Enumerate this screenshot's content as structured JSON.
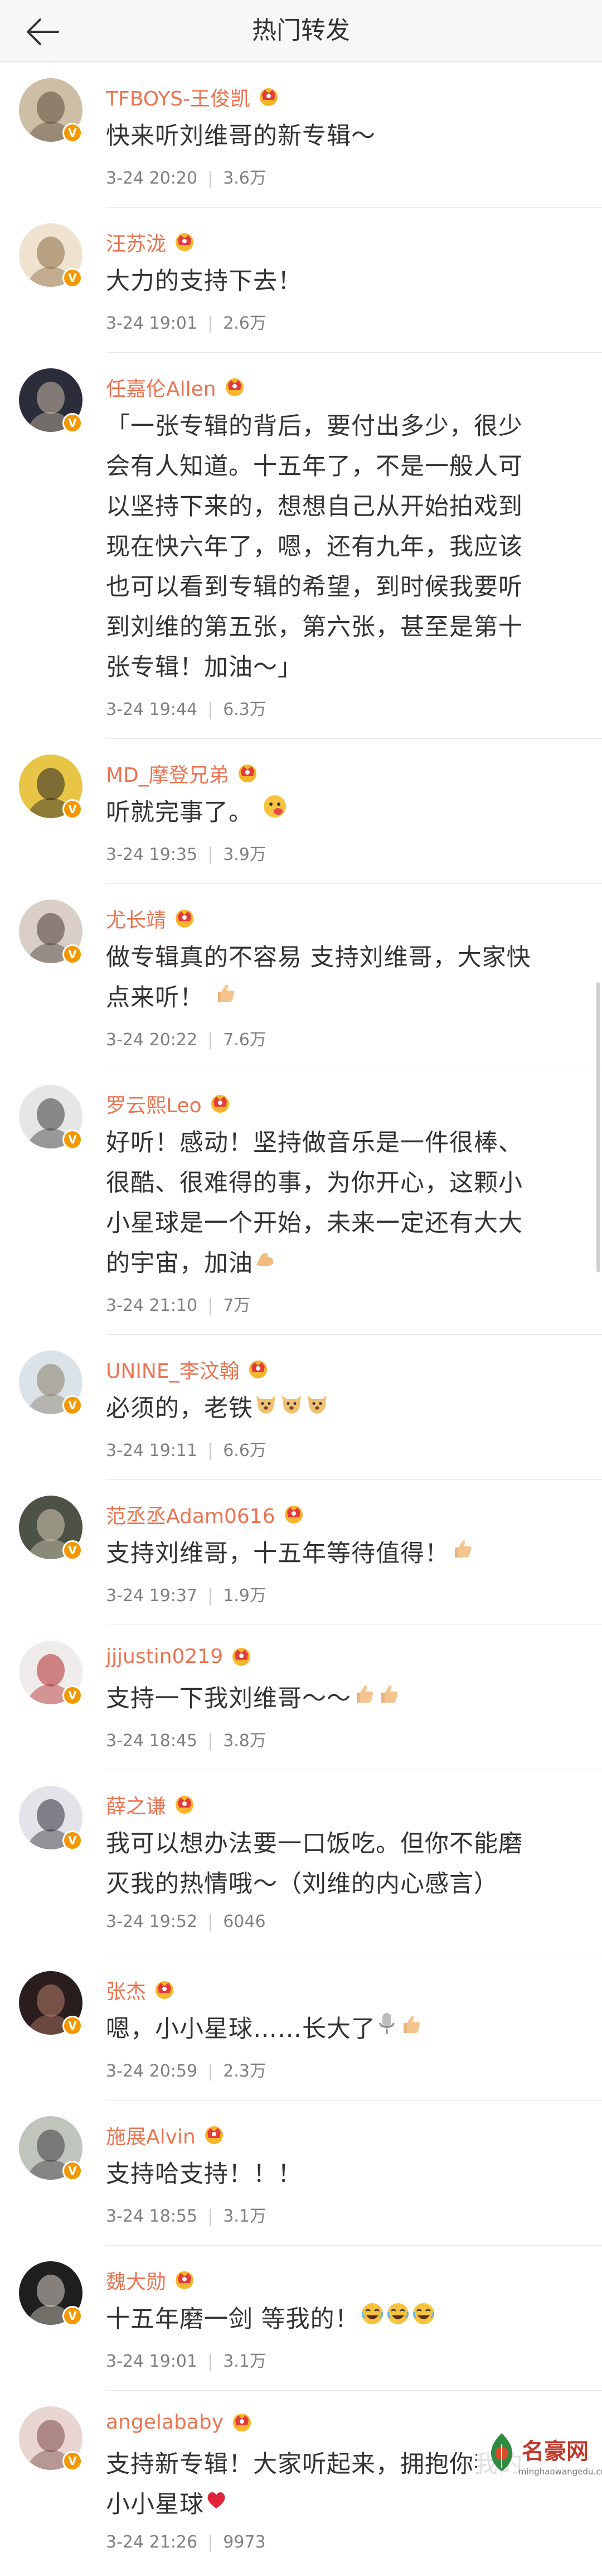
{
  "header": {
    "title": "热门转发"
  },
  "posts": [
    {
      "name": "TFBOYS-王俊凯",
      "lines": [
        "快来听刘维哥的新专辑～"
      ],
      "time": "3-24 20:20",
      "likes": "3.6万",
      "avatar_bg": "#cdbfa6",
      "avatar_fg": "#5b4a3a",
      "emoji": ""
    },
    {
      "name": "汪苏泷",
      "lines": [
        "大力的支持下去！"
      ],
      "time": "3-24 19:01",
      "likes": "2.6万",
      "avatar_bg": "#efe3cf",
      "avatar_fg": "#8b6a45",
      "emoji": ""
    },
    {
      "name": "任嘉伦Allen",
      "lines": [
        "「一张专辑的背后，要付出多少，很少",
        "会有人知道。十五年了，不是一般人可",
        "以坚持下来的，想想自己从开始拍戏到",
        "现在快六年了，嗯，还有九年，我应该",
        "也可以看到专辑的希望，到时候我要听",
        "到刘维的第五张，第六张，甚至是第十",
        "张专辑！加油～」"
      ],
      "time": "3-24 19:44",
      "likes": "6.3万",
      "avatar_bg": "#2b2e3a",
      "avatar_fg": "#c9b9a8",
      "emoji": ""
    },
    {
      "name": "MD_摩登兄弟",
      "lines": [
        "听就完事了。"
      ],
      "time": "3-24 19:35",
      "likes": "3.9万",
      "avatar_bg": "#e8c547",
      "avatar_fg": "#222222",
      "emoji": "face"
    },
    {
      "name": "尤长靖",
      "lines": [
        "做专辑真的不容易 支持刘维哥，大家快",
        "点来听！"
      ],
      "time": "3-24 20:22",
      "likes": "7.6万",
      "avatar_bg": "#d9cfc8",
      "avatar_fg": "#4a3b35",
      "emoji": "thumb"
    },
    {
      "name": "罗云熙Leo",
      "lines": [
        "好听！感动！坚持做音乐是一件很棒、",
        "很酷、很难得的事，为你开心，这颗小",
        "小星球是一个开始，未来一定还有大大",
        "的宇宙，加油"
      ],
      "time": "3-24 21:10",
      "likes": "7万",
      "avatar_bg": "#e6e6e6",
      "avatar_fg": "#3a3a3a",
      "emoji": "muscle"
    },
    {
      "name": "UNINE_李汶翰",
      "lines": [
        "必须的，老铁"
      ],
      "time": "3-24 19:11",
      "likes": "6.6万",
      "avatar_bg": "#dbe3e8",
      "avatar_fg": "#8a7b68",
      "emoji": "doge3"
    },
    {
      "name": "范丞丞Adam0616",
      "lines": [
        "支持刘维哥，十五年等待值得！"
      ],
      "time": "3-24 19:37",
      "likes": "1.9万",
      "avatar_bg": "#4d5246",
      "avatar_fg": "#d7cbb8",
      "emoji": "thumb-inline"
    },
    {
      "name": "jjjustin0219",
      "lines": [
        "支持一下我刘维哥～～"
      ],
      "time": "3-24 18:45",
      "likes": "3.8万",
      "avatar_bg": "#f1ecec",
      "avatar_fg": "#b02a2a",
      "emoji": "thumb2"
    },
    {
      "name": "薛之谦",
      "lines": [
        "我可以想办法要一口饭吃。但你不能磨",
        "灭我的热情哦～（刘维的内心感言）"
      ],
      "time": "3-24 19:52",
      "likes": "6046",
      "avatar_bg": "#e2e4ea",
      "avatar_fg": "#2e2e35",
      "emoji": ""
    },
    {
      "name": "张杰",
      "lines": [
        "嗯，小小星球……长大了"
      ],
      "time": "3-24 20:59",
      "likes": "2.3万",
      "avatar_bg": "#2a1d1d",
      "avatar_fg": "#b77d6a",
      "emoji": "mic-thumb"
    },
    {
      "name": "施展Alvin",
      "lines": [
        "支持哈支持！！！"
      ],
      "time": "3-24 18:55",
      "likes": "3.1万",
      "avatar_bg": "#bfc4bd",
      "avatar_fg": "#3c3c3c",
      "emoji": ""
    },
    {
      "name": "魏大勋",
      "lines": [
        "十五年磨一剑 等我的！"
      ],
      "time": "3-24 19:01",
      "likes": "3.1万",
      "avatar_bg": "#1f1f1f",
      "avatar_fg": "#d8d0c8",
      "emoji": "laugh3"
    },
    {
      "name": "angelababy",
      "lines": [
        "支持新专辑！大家听起来，拥抱你我的",
        "小小星球"
      ],
      "time": "3-24 21:26",
      "likes": "9973",
      "avatar_bg": "#e9d6d3",
      "avatar_fg": "#7a4b45",
      "emoji": "heart"
    }
  ],
  "watermark": {
    "name": "名豪网",
    "url": "minghaowangedu.cn"
  },
  "colors": {
    "name": "#eb7350",
    "badge": "#f39800",
    "meta": "#808080"
  }
}
